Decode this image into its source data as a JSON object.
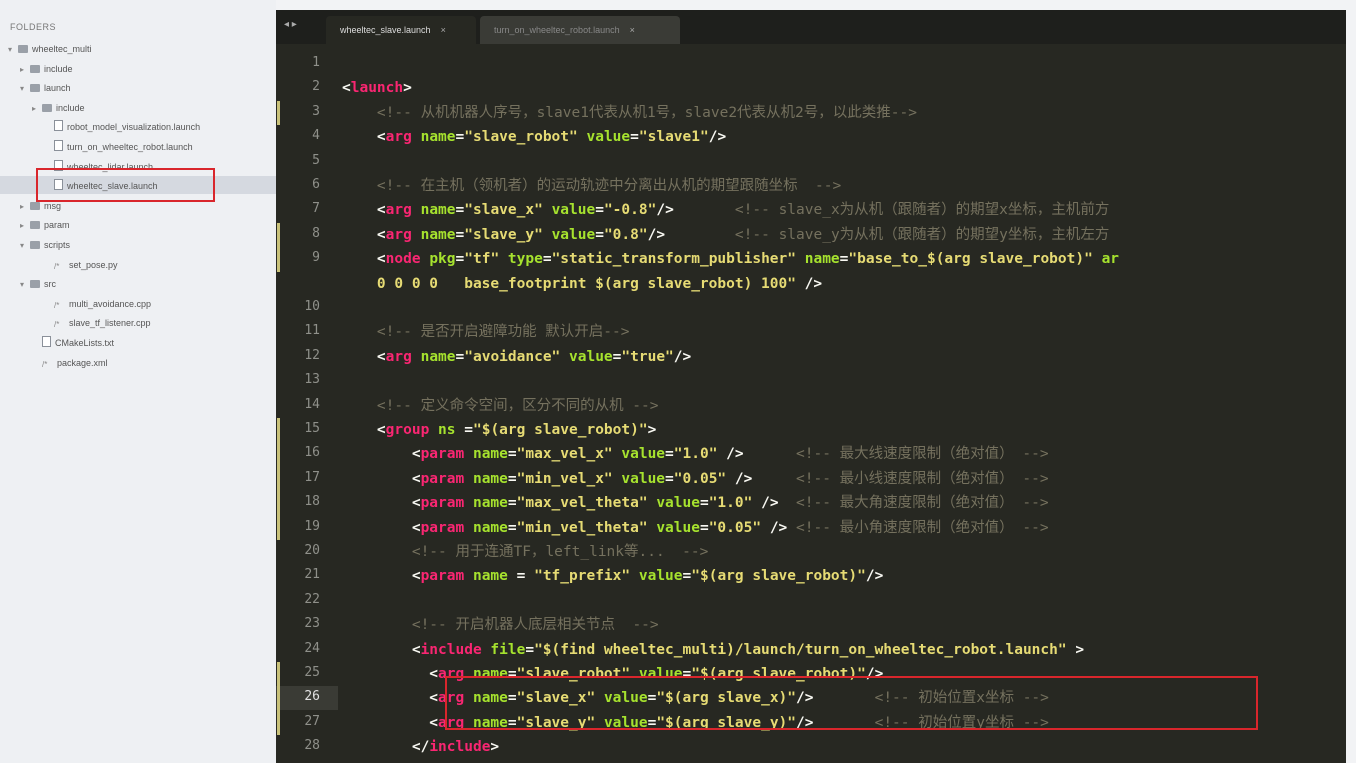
{
  "sidebar": {
    "title": "FOLDERS",
    "items": [
      {
        "label": "wheeltec_multi",
        "arrow": "▾",
        "icon": "folder"
      },
      {
        "label": "include",
        "arrow": "▸",
        "icon": "folder"
      },
      {
        "label": "launch",
        "arrow": "▾",
        "icon": "folder"
      },
      {
        "label": "include",
        "arrow": "▸",
        "icon": "folder"
      },
      {
        "label": "robot_model_visualization.launch",
        "arrow": "",
        "icon": "file"
      },
      {
        "label": "turn_on_wheeltec_robot.launch",
        "arrow": "",
        "icon": "file"
      },
      {
        "label": "wheeltec_lidar.launch",
        "arrow": "",
        "icon": "file"
      },
      {
        "label": "wheeltec_slave.launch",
        "arrow": "",
        "icon": "file"
      },
      {
        "label": "msg",
        "arrow": "▸",
        "icon": "folder"
      },
      {
        "label": "param",
        "arrow": "▸",
        "icon": "folder"
      },
      {
        "label": "scripts",
        "arrow": "▾",
        "icon": "folder"
      },
      {
        "label": "set_pose.py",
        "arrow": "",
        "icon": "code"
      },
      {
        "label": "src",
        "arrow": "▾",
        "icon": "folder"
      },
      {
        "label": "multi_avoidance.cpp",
        "arrow": "",
        "icon": "code"
      },
      {
        "label": "slave_tf_listener.cpp",
        "arrow": "",
        "icon": "code"
      },
      {
        "label": "CMakeLists.txt",
        "arrow": "",
        "icon": "file"
      },
      {
        "label": "package.xml",
        "arrow": "",
        "icon": "code"
      }
    ]
  },
  "editor": {
    "nav_arrows": "◂ ▸",
    "tabs": [
      {
        "label": "wheeltec_slave.launch",
        "close": "×"
      },
      {
        "label": "turn_on_wheeltec_robot.launch",
        "close": "×"
      }
    ],
    "lines": [
      {
        "n": "1",
        "segs": []
      },
      {
        "n": "2",
        "segs": [
          [
            "p",
            "<"
          ],
          [
            "tag",
            "launch"
          ],
          [
            "p",
            ">"
          ]
        ]
      },
      {
        "n": "3",
        "segs": [
          [
            "p",
            "    "
          ],
          [
            "cm",
            "<!-- 从机机器人序号，slave1代表从机1号，slave2代表从机2号，以此类推-->"
          ]
        ]
      },
      {
        "n": "4",
        "segs": [
          [
            "p",
            "    <"
          ],
          [
            "tag",
            "arg"
          ],
          [
            "p",
            " "
          ],
          [
            "attr",
            "name"
          ],
          [
            "p",
            "="
          ],
          [
            "str",
            "\"slave_robot\""
          ],
          [
            "p",
            " "
          ],
          [
            "attr",
            "value"
          ],
          [
            "p",
            "="
          ],
          [
            "str",
            "\"slave1\""
          ],
          [
            "p",
            "/>"
          ]
        ]
      },
      {
        "n": "5",
        "segs": []
      },
      {
        "n": "6",
        "segs": [
          [
            "p",
            "    "
          ],
          [
            "cm",
            "<!-- 在主机（领机者）的运动轨迹中分离出从机的期望跟随坐标  -->"
          ]
        ]
      },
      {
        "n": "7",
        "segs": [
          [
            "p",
            "    <"
          ],
          [
            "tag",
            "arg"
          ],
          [
            "p",
            " "
          ],
          [
            "attr",
            "name"
          ],
          [
            "p",
            "="
          ],
          [
            "str",
            "\"slave_x\""
          ],
          [
            "p",
            " "
          ],
          [
            "attr",
            "value"
          ],
          [
            "p",
            "="
          ],
          [
            "str",
            "\"-0.8\""
          ],
          [
            "p",
            "/>       "
          ],
          [
            "cm",
            "<!-- slave_x为从机（跟随者）的期望x坐标，主机前方"
          ]
        ]
      },
      {
        "n": "8",
        "segs": [
          [
            "p",
            "    <"
          ],
          [
            "tag",
            "arg"
          ],
          [
            "p",
            " "
          ],
          [
            "attr",
            "name"
          ],
          [
            "p",
            "="
          ],
          [
            "str",
            "\"slave_y\""
          ],
          [
            "p",
            " "
          ],
          [
            "attr",
            "value"
          ],
          [
            "p",
            "="
          ],
          [
            "str",
            "\"0.8\""
          ],
          [
            "p",
            "/>        "
          ],
          [
            "cm",
            "<!-- slave_y为从机（跟随者）的期望y坐标，主机左方"
          ]
        ]
      },
      {
        "n": "9",
        "segs": [
          [
            "p",
            "    <"
          ],
          [
            "tag",
            "node"
          ],
          [
            "p",
            " "
          ],
          [
            "attr",
            "pkg"
          ],
          [
            "p",
            "="
          ],
          [
            "str",
            "\"tf\""
          ],
          [
            "p",
            " "
          ],
          [
            "attr",
            "type"
          ],
          [
            "p",
            "="
          ],
          [
            "str",
            "\"static_transform_publisher\""
          ],
          [
            "p",
            " "
          ],
          [
            "attr",
            "name"
          ],
          [
            "p",
            "="
          ],
          [
            "str",
            "\"base_to_$(arg slave_robot)\""
          ],
          [
            "p",
            " "
          ],
          [
            "attr",
            "ar"
          ]
        ]
      },
      {
        "n": "",
        "segs": [
          [
            "p",
            "    "
          ],
          [
            "str",
            "0 0 0 0   base_footprint $(arg slave_robot) 100\""
          ],
          [
            "p",
            " />"
          ]
        ]
      },
      {
        "n": "10",
        "segs": []
      },
      {
        "n": "11",
        "segs": [
          [
            "p",
            "    "
          ],
          [
            "cm",
            "<!-- 是否开启避障功能 默认开启-->"
          ]
        ]
      },
      {
        "n": "12",
        "segs": [
          [
            "p",
            "    <"
          ],
          [
            "tag",
            "arg"
          ],
          [
            "p",
            " "
          ],
          [
            "attr",
            "name"
          ],
          [
            "p",
            "="
          ],
          [
            "str",
            "\"avoidance\""
          ],
          [
            "p",
            " "
          ],
          [
            "attr",
            "value"
          ],
          [
            "p",
            "="
          ],
          [
            "str",
            "\"true\""
          ],
          [
            "p",
            "/>"
          ]
        ]
      },
      {
        "n": "13",
        "segs": []
      },
      {
        "n": "14",
        "segs": [
          [
            "p",
            "    "
          ],
          [
            "cm",
            "<!-- 定义命令空间，区分不同的从机 -->"
          ]
        ]
      },
      {
        "n": "15",
        "segs": [
          [
            "p",
            "    <"
          ],
          [
            "tag",
            "group"
          ],
          [
            "p",
            " "
          ],
          [
            "attr",
            "ns"
          ],
          [
            "p",
            " ="
          ],
          [
            "str",
            "\"$(arg slave_robot)\""
          ],
          [
            "p",
            ">"
          ]
        ]
      },
      {
        "n": "16",
        "segs": [
          [
            "p",
            "        <"
          ],
          [
            "tag",
            "param"
          ],
          [
            "p",
            " "
          ],
          [
            "attr",
            "name"
          ],
          [
            "p",
            "="
          ],
          [
            "str",
            "\"max_vel_x\""
          ],
          [
            "p",
            " "
          ],
          [
            "attr",
            "value"
          ],
          [
            "p",
            "="
          ],
          [
            "str",
            "\"1.0\""
          ],
          [
            "p",
            " />      "
          ],
          [
            "cm",
            "<!-- 最大线速度限制（绝对值） -->"
          ]
        ]
      },
      {
        "n": "17",
        "segs": [
          [
            "p",
            "        <"
          ],
          [
            "tag",
            "param"
          ],
          [
            "p",
            " "
          ],
          [
            "attr",
            "name"
          ],
          [
            "p",
            "="
          ],
          [
            "str",
            "\"min_vel_x\""
          ],
          [
            "p",
            " "
          ],
          [
            "attr",
            "value"
          ],
          [
            "p",
            "="
          ],
          [
            "str",
            "\"0.05\""
          ],
          [
            "p",
            " />     "
          ],
          [
            "cm",
            "<!-- 最小线速度限制（绝对值） -->"
          ]
        ]
      },
      {
        "n": "18",
        "segs": [
          [
            "p",
            "        <"
          ],
          [
            "tag",
            "param"
          ],
          [
            "p",
            " "
          ],
          [
            "attr",
            "name"
          ],
          [
            "p",
            "="
          ],
          [
            "str",
            "\"max_vel_theta\""
          ],
          [
            "p",
            " "
          ],
          [
            "attr",
            "value"
          ],
          [
            "p",
            "="
          ],
          [
            "str",
            "\"1.0\""
          ],
          [
            "p",
            " />  "
          ],
          [
            "cm",
            "<!-- 最大角速度限制（绝对值） -->"
          ]
        ]
      },
      {
        "n": "19",
        "segs": [
          [
            "p",
            "        <"
          ],
          [
            "tag",
            "param"
          ],
          [
            "p",
            " "
          ],
          [
            "attr",
            "name"
          ],
          [
            "p",
            "="
          ],
          [
            "str",
            "\"min_vel_theta\""
          ],
          [
            "p",
            " "
          ],
          [
            "attr",
            "value"
          ],
          [
            "p",
            "="
          ],
          [
            "str",
            "\"0.05\""
          ],
          [
            "p",
            " /> "
          ],
          [
            "cm",
            "<!-- 最小角速度限制（绝对值） -->"
          ]
        ]
      },
      {
        "n": "20",
        "segs": [
          [
            "p",
            "        "
          ],
          [
            "cm",
            "<!-- 用于连通TF，left_link等...  -->"
          ]
        ]
      },
      {
        "n": "21",
        "segs": [
          [
            "p",
            "        <"
          ],
          [
            "tag",
            "param"
          ],
          [
            "p",
            " "
          ],
          [
            "attr",
            "name"
          ],
          [
            "p",
            " = "
          ],
          [
            "str",
            "\"tf_prefix\""
          ],
          [
            "p",
            " "
          ],
          [
            "attr",
            "value"
          ],
          [
            "p",
            "="
          ],
          [
            "str",
            "\"$(arg slave_robot)\""
          ],
          [
            "p",
            "/>"
          ]
        ]
      },
      {
        "n": "22",
        "segs": []
      },
      {
        "n": "23",
        "segs": [
          [
            "p",
            "        "
          ],
          [
            "cm",
            "<!-- 开启机器人底层相关节点  -->"
          ]
        ]
      },
      {
        "n": "24",
        "segs": [
          [
            "p",
            "        <"
          ],
          [
            "tag",
            "include"
          ],
          [
            "p",
            " "
          ],
          [
            "attr",
            "file"
          ],
          [
            "p",
            "="
          ],
          [
            "str",
            "\"$(find wheeltec_multi)/launch/turn_on_wheeltec_robot.launch\""
          ],
          [
            "p",
            " >"
          ]
        ]
      },
      {
        "n": "25",
        "segs": [
          [
            "p",
            "          <"
          ],
          [
            "tag",
            "arg"
          ],
          [
            "p",
            " "
          ],
          [
            "attr",
            "name"
          ],
          [
            "p",
            "="
          ],
          [
            "str",
            "\"slave_robot\""
          ],
          [
            "p",
            " "
          ],
          [
            "attr",
            "value"
          ],
          [
            "p",
            "="
          ],
          [
            "str",
            "\"$(arg slave_robot)\""
          ],
          [
            "p",
            "/>"
          ]
        ]
      },
      {
        "n": "26",
        "segs": [
          [
            "p",
            "          <"
          ],
          [
            "tag",
            "arg"
          ],
          [
            "p",
            " "
          ],
          [
            "attr",
            "name"
          ],
          [
            "p",
            "="
          ],
          [
            "str",
            "\"slave_x\""
          ],
          [
            "p",
            " "
          ],
          [
            "attr",
            "value"
          ],
          [
            "p",
            "="
          ],
          [
            "str",
            "\"$(arg slave_x)\""
          ],
          [
            "p",
            "/>       "
          ],
          [
            "cm",
            "<!-- 初始位置x坐标 -->"
          ]
        ]
      },
      {
        "n": "27",
        "segs": [
          [
            "p",
            "          <"
          ],
          [
            "tag",
            "arg"
          ],
          [
            "p",
            " "
          ],
          [
            "attr",
            "name"
          ],
          [
            "p",
            "="
          ],
          [
            "str",
            "\"slave_y\""
          ],
          [
            "p",
            " "
          ],
          [
            "attr",
            "value"
          ],
          [
            "p",
            "="
          ],
          [
            "str",
            "\"$(arg slave_y)\""
          ],
          [
            "p",
            "/>       "
          ],
          [
            "cm",
            "<!-- 初始位置y坐标 -->"
          ]
        ]
      },
      {
        "n": "28",
        "segs": [
          [
            "p",
            "        </"
          ],
          [
            "tag",
            "include"
          ],
          [
            "p",
            ">"
          ]
        ]
      }
    ]
  },
  "colors": {
    "tag": "#f92672",
    "attr": "#a6e22e",
    "string": "#e6db74",
    "comment": "#75715e",
    "highlight_box": "#d9262c",
    "editor_bg": "#272822"
  }
}
